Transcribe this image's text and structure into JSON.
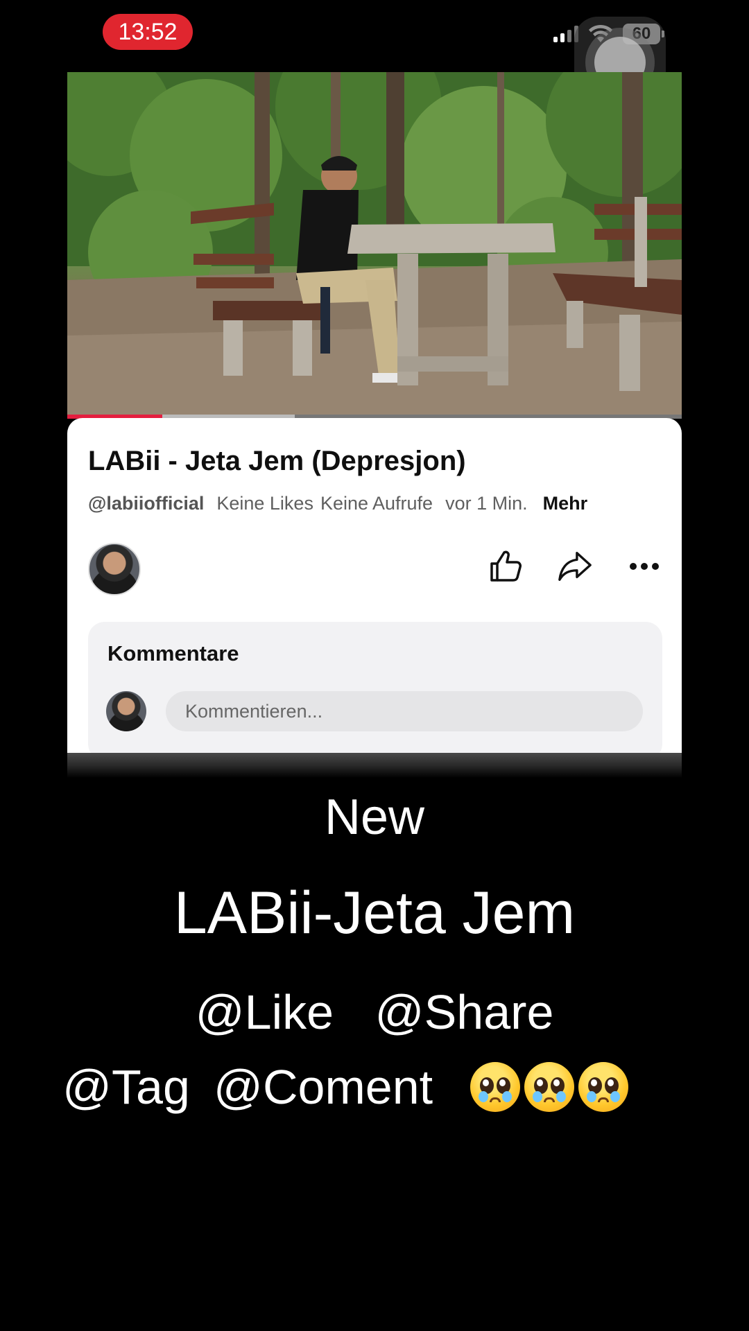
{
  "status_bar": {
    "time": "13:52",
    "battery": "60",
    "icons": [
      "cellular-signal-icon",
      "wifi-icon",
      "battery-icon"
    ]
  },
  "video": {
    "progress_fraction": 0.155,
    "buffered_fraction": 0.37,
    "progress_color": "#e41e3f"
  },
  "details": {
    "title": "LABii - Jeta Jem (Depresjon)",
    "channel_handle": "@labiiofficial",
    "likes_text": "Keine Likes",
    "views_text": "Keine Aufrufe",
    "time_text": "vor 1 Min.",
    "more_label": "Mehr"
  },
  "actions": [
    "like-icon",
    "share-icon",
    "more-options-icon"
  ],
  "comments": {
    "title": "Kommentare",
    "placeholder": "Kommentieren..."
  },
  "overlay": {
    "line1": "New",
    "line2": "LABii-Jeta Jem",
    "like_tag": "@Like",
    "share_tag": "@Share",
    "tag_tag": "@Tag",
    "comment_tag": "@Coment",
    "emoji_count": 3
  }
}
